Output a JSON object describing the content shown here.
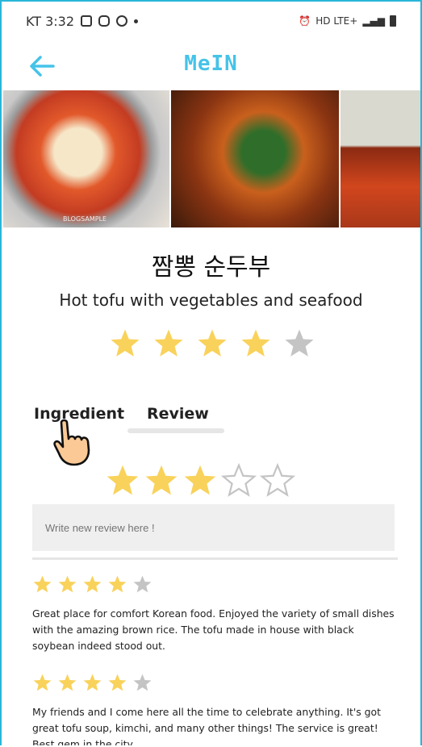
{
  "status": {
    "carrier_time": "KT 3:32",
    "network": "HD LTE+"
  },
  "app": {
    "title": "MeIN"
  },
  "photos": {
    "watermark": "BLOGSAMPLE"
  },
  "dish": {
    "name": "짬뽕 순두부",
    "description": "Hot tofu with vegetables and seafood",
    "rating": 4,
    "rating_max": 5
  },
  "tabs": [
    {
      "label": "Ingredient"
    },
    {
      "label": "Review"
    }
  ],
  "review_input": {
    "rating": 3,
    "rating_max": 5,
    "placeholder": "Write new review here !"
  },
  "reviews": [
    {
      "rating": 4,
      "text": "Great place for comfort Korean food. Enjoyed the variety of small dishes with the amazing brown rice. The tofu made in house with black soybean indeed stood out."
    },
    {
      "rating": 4,
      "text": "My friends and I come here all the time to celebrate anything. It's got great tofu soup, kimchi, and many other things! The service is great! Best gem in the city."
    }
  ],
  "colors": {
    "accent": "#45c3e8",
    "star_filled": "#f9d25b",
    "star_empty": "#c4c4c4",
    "border": "#29b6d9"
  }
}
